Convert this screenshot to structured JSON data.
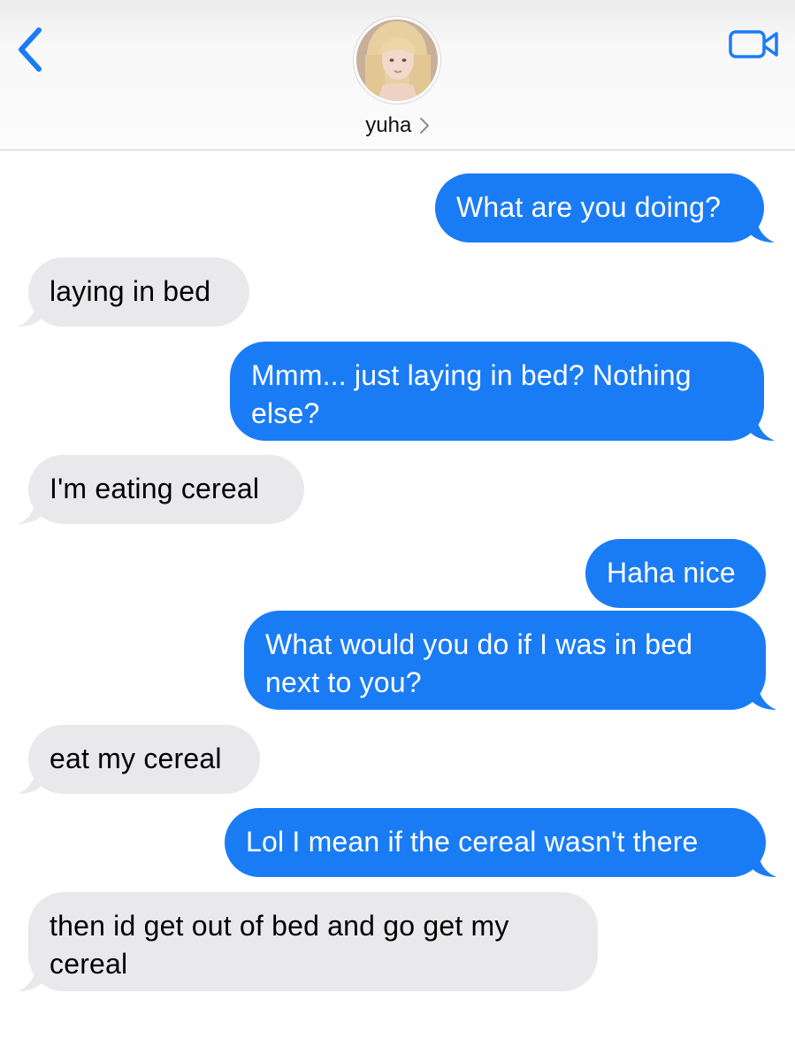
{
  "header": {
    "contact_name": "yuha",
    "back_icon": "chevron-left-icon",
    "video_icon": "video-camera-icon",
    "accent_color": "#1a7cf5"
  },
  "messages": [
    {
      "from": "me",
      "text": "What are you doing?"
    },
    {
      "from": "them",
      "text": "laying in bed"
    },
    {
      "from": "me",
      "text": "Mmm... just laying in bed? Nothing else?"
    },
    {
      "from": "them",
      "text": "I'm eating cereal"
    },
    {
      "from": "me",
      "text": "Haha nice"
    },
    {
      "from": "me",
      "text": "What would you do if I was in bed next to you?"
    },
    {
      "from": "them",
      "text": "eat my cereal"
    },
    {
      "from": "me",
      "text": "Lol I mean if the cereal wasn't there"
    },
    {
      "from": "them",
      "text": "then id get out of bed and go get my cereal"
    }
  ],
  "colors": {
    "sent_bubble": "#1a7cf5",
    "received_bubble": "#e9e9eb"
  }
}
